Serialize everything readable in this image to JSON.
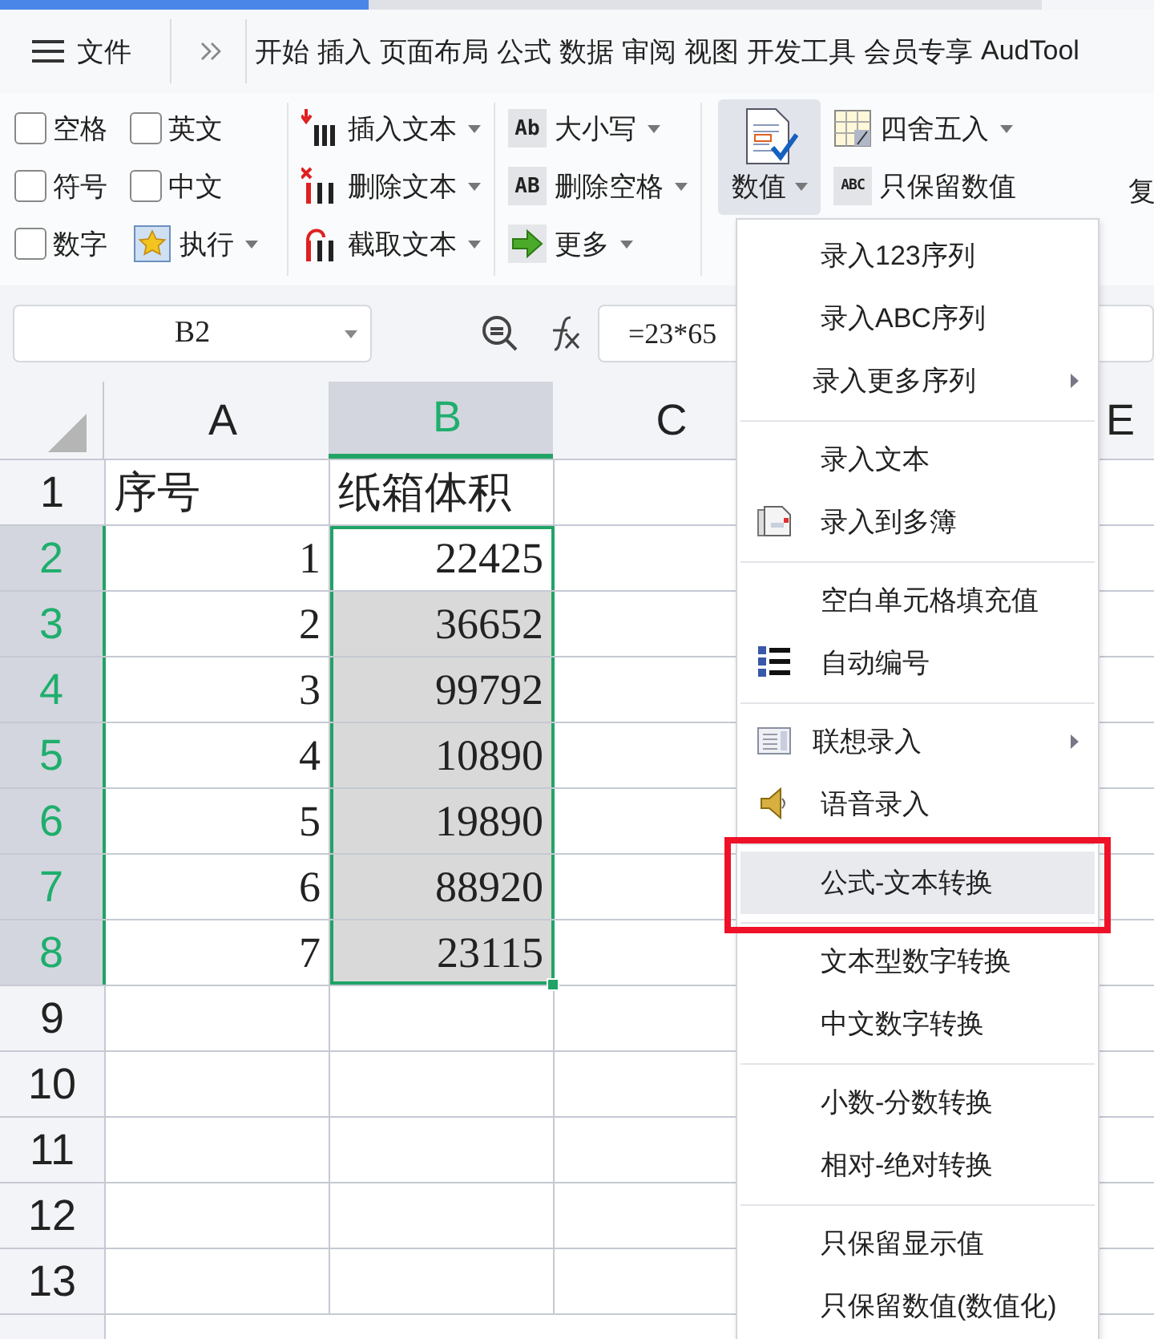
{
  "menu_bar": {
    "file_label": "文件",
    "tabs": [
      "开始",
      "插入",
      "页面布局",
      "公式",
      "数据",
      "审阅",
      "视图",
      "开发工具",
      "会员专享",
      "AudTool"
    ]
  },
  "ribbon": {
    "checkboxes": [
      {
        "label": "空格",
        "checked": false
      },
      {
        "label": "英文",
        "checked": false
      },
      {
        "label": "符号",
        "checked": false
      },
      {
        "label": "中文",
        "checked": false
      },
      {
        "label": "数字",
        "checked": false
      }
    ],
    "run_button": {
      "label": "执行",
      "dropdown": true
    },
    "text_tools": [
      {
        "label": "插入文本",
        "dropdown": true
      },
      {
        "label": "删除文本",
        "dropdown": true
      },
      {
        "label": "截取文本",
        "dropdown": true
      }
    ],
    "case_tools": [
      {
        "icon_text": "Ab",
        "label": "大小写",
        "dropdown": true
      },
      {
        "icon_text": "AB",
        "label": "删除空格",
        "dropdown": true
      },
      {
        "label": "更多",
        "dropdown": true
      }
    ],
    "value_button": {
      "label": "数值",
      "dropdown": true,
      "open": true
    },
    "value_tools": [
      {
        "label": "四舍五入",
        "dropdown": true
      },
      {
        "icon_text": "ABC",
        "label": "只保留数值",
        "dropdown": false
      }
    ],
    "cut_label": "复"
  },
  "name_box": "B2",
  "formula": "=23*65",
  "sheet": {
    "columns": [
      {
        "label": "A",
        "selected": false
      },
      {
        "label": "B",
        "selected": true
      },
      {
        "label": "C",
        "selected": false
      },
      {
        "label": "E",
        "selected": false
      }
    ],
    "rows": [
      {
        "number": "1",
        "selected": false,
        "cells": [
          {
            "text": "序号",
            "selected": false
          },
          {
            "text": "纸箱体积",
            "selected": false
          }
        ]
      },
      {
        "number": "2",
        "selected": true,
        "cells": [
          {
            "text": "1",
            "selected": false
          },
          {
            "text": "22425",
            "selected": true,
            "active": true
          }
        ]
      },
      {
        "number": "3",
        "selected": true,
        "cells": [
          {
            "text": "2",
            "selected": false
          },
          {
            "text": "36652",
            "selected": true,
            "active": false
          }
        ]
      },
      {
        "number": "4",
        "selected": true,
        "cells": [
          {
            "text": "3",
            "selected": false
          },
          {
            "text": "99792",
            "selected": true,
            "active": false
          }
        ]
      },
      {
        "number": "5",
        "selected": true,
        "cells": [
          {
            "text": "4",
            "selected": false
          },
          {
            "text": "10890",
            "selected": true,
            "active": false
          }
        ]
      },
      {
        "number": "6",
        "selected": true,
        "cells": [
          {
            "text": "5",
            "selected": false
          },
          {
            "text": "19890",
            "selected": true,
            "active": false
          }
        ]
      },
      {
        "number": "7",
        "selected": true,
        "cells": [
          {
            "text": "6",
            "selected": false
          },
          {
            "text": "88920",
            "selected": true,
            "active": false
          }
        ]
      },
      {
        "number": "8",
        "selected": true,
        "cells": [
          {
            "text": "7",
            "selected": false
          },
          {
            "text": "23115",
            "selected": true,
            "active": false
          }
        ]
      },
      {
        "number": "9",
        "selected": false
      },
      {
        "number": "10",
        "selected": false
      },
      {
        "number": "11",
        "selected": false
      },
      {
        "number": "12",
        "selected": false
      },
      {
        "number": "13",
        "selected": false
      }
    ]
  },
  "context_menu": {
    "sections": [
      {
        "items": [
          {
            "label": "录入123序列",
            "submenu": false,
            "highlighted": false,
            "annotated": false
          },
          {
            "label": "录入ABC序列",
            "submenu": false,
            "highlighted": false,
            "annotated": false
          },
          {
            "label": "录入更多序列",
            "submenu": true,
            "highlighted": false,
            "annotated": false
          }
        ]
      },
      {
        "items": [
          {
            "label": "录入文本",
            "submenu": false,
            "highlighted": false,
            "annotated": false
          },
          {
            "label": "录入到多簿",
            "submenu": false,
            "highlighted": false,
            "annotated": false
          }
        ]
      },
      {
        "items": [
          {
            "label": "空白单元格填充值",
            "submenu": false,
            "highlighted": false,
            "annotated": false
          },
          {
            "label": "自动编号",
            "submenu": false,
            "highlighted": false,
            "annotated": false
          }
        ]
      },
      {
        "items": [
          {
            "label": "联想录入",
            "submenu": true,
            "highlighted": false,
            "annotated": false
          },
          {
            "label": "语音录入",
            "submenu": false,
            "highlighted": false,
            "annotated": false
          }
        ]
      },
      {
        "items": [
          {
            "label": "公式-文本转换",
            "submenu": false,
            "highlighted": true,
            "annotated": true
          }
        ]
      },
      {
        "items": [
          {
            "label": "文本型数字转换",
            "submenu": false,
            "highlighted": false,
            "annotated": false
          },
          {
            "label": "中文数字转换",
            "submenu": false,
            "highlighted": false,
            "annotated": false
          }
        ]
      },
      {
        "items": [
          {
            "label": "小数-分数转换",
            "submenu": false,
            "highlighted": false,
            "annotated": false
          },
          {
            "label": "相对-绝对转换",
            "submenu": false,
            "highlighted": false,
            "annotated": false
          }
        ]
      },
      {
        "items": [
          {
            "label": "只保留显示值",
            "submenu": false,
            "highlighted": false,
            "annotated": false
          },
          {
            "label": "只保留数值(数值化)",
            "submenu": false,
            "highlighted": false,
            "annotated": false
          }
        ]
      }
    ]
  }
}
